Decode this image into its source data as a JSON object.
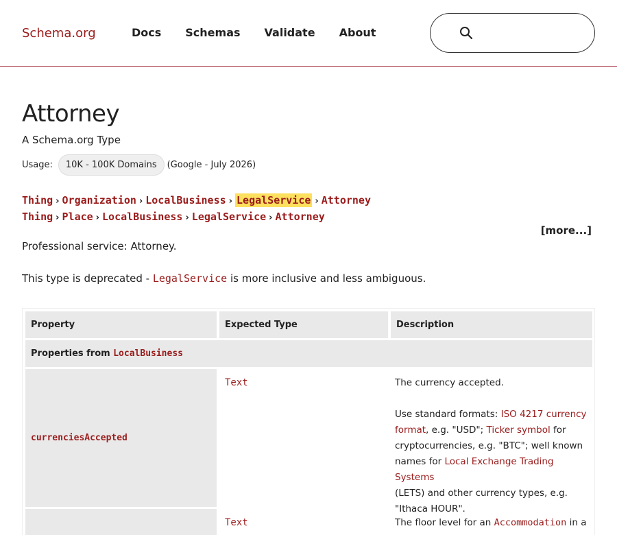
{
  "header": {
    "logo": "Schema.org",
    "nav": [
      {
        "label": "Docs"
      },
      {
        "label": "Schemas"
      },
      {
        "label": "Validate"
      },
      {
        "label": "About"
      }
    ],
    "search": {
      "placeholder": "",
      "value": ""
    }
  },
  "page": {
    "title": "Attorney",
    "subtitle": "A Schema.org Type",
    "usage_label": "Usage:",
    "usage_value": "10K - 100K Domains",
    "usage_source": "(Google - July 2026)"
  },
  "breadcrumbs": [
    [
      "Thing",
      "Organization",
      "LocalBusiness",
      "LegalService",
      "Attorney"
    ],
    [
      "Thing",
      "Place",
      "LocalBusiness",
      "LegalService",
      "Attorney"
    ]
  ],
  "breadcrumb_separator": "›",
  "more_label": "[more...]",
  "description": "Professional service: Attorney.",
  "deprecated": {
    "before": "This type is deprecated - ",
    "link": "LegalService",
    "after": " is more inclusive and less ambiguous."
  },
  "table": {
    "headers": [
      "Property",
      "Expected Type",
      "Description"
    ],
    "section_prefix": "Properties from ",
    "section_type": "LocalBusiness",
    "rows": [
      {
        "property": "currenciesAccepted",
        "type": "Text",
        "desc1": "The currency accepted.",
        "desc2_parts": {
          "a": "Use standard formats: ",
          "l1": "ISO 4217 currency",
          "l1b": "format",
          "b": ", e.g. \"USD\"; ",
          "l2": "Ticker symbol",
          "c": " for",
          "d": "cryptocurrencies, e.g. \"BTC\"; well known",
          "e": "names for ",
          "l3": "Local Exchange Trading Systems",
          "f": "(LETS) and other currency types, e.g.",
          "g": "\"Ithaca HOUR\"."
        }
      },
      {
        "property": "",
        "type": "Text",
        "desc_a": "The floor level for an ",
        "desc_link": "Accommodation",
        "desc_b": " in a"
      }
    ]
  }
}
